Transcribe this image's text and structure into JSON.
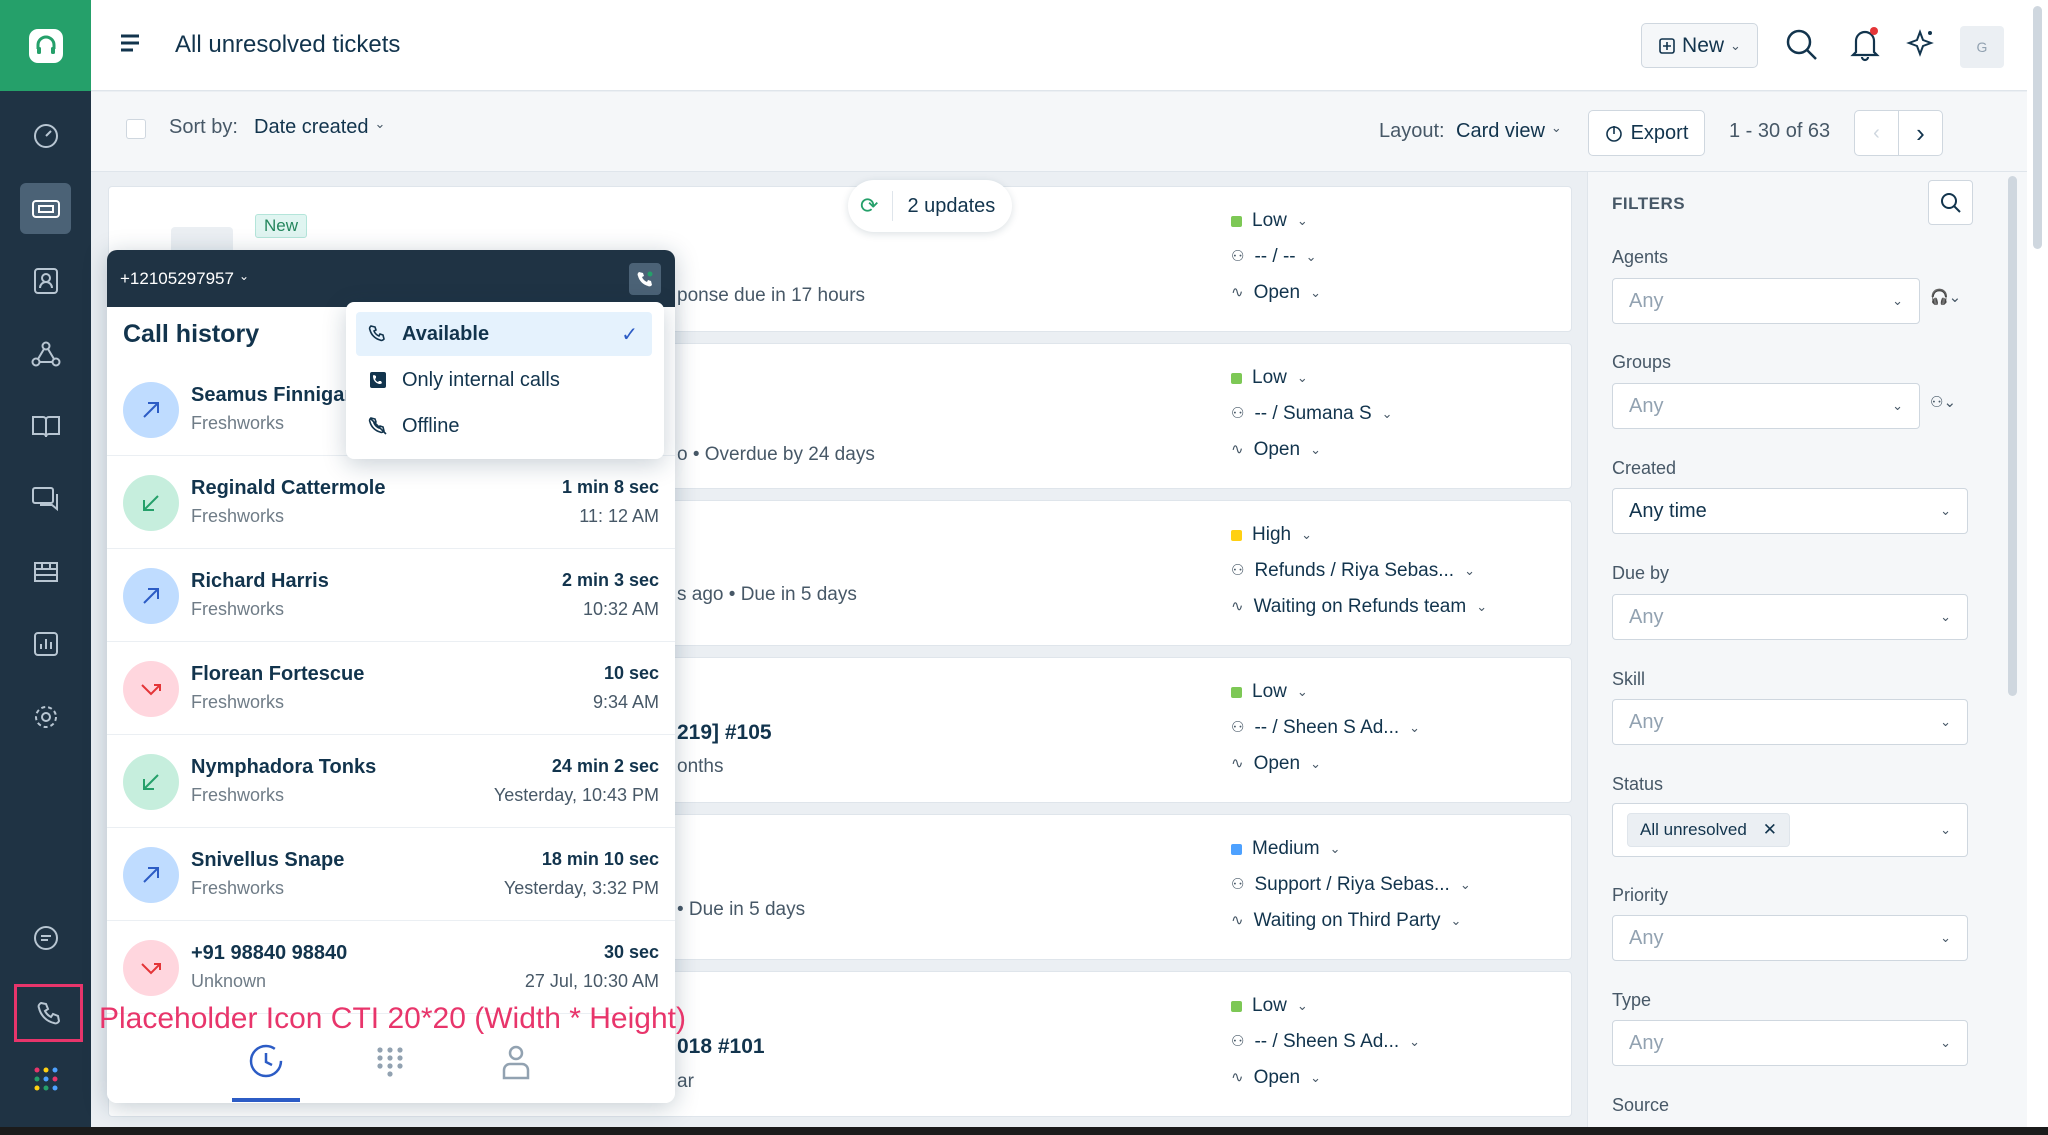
{
  "header": {
    "title": "All unresolved tickets",
    "new_label": "New",
    "avatar_initial": "G"
  },
  "toolbar": {
    "sort_label": "Sort by:",
    "sort_value": "Date created",
    "layout_label": "Layout:",
    "layout_value": "Card view",
    "export_label": "Export",
    "pagination": "1 - 30 of 63"
  },
  "updates_pill": "2 updates",
  "tickets": [
    {
      "badge": "New",
      "snippet": "ponse due in 17 hours",
      "priority": "Low",
      "priority_color": "#7dc855",
      "assignee": "-- / --",
      "status": "Open"
    },
    {
      "snippet": "o • Overdue by 24 days",
      "priority": "Low",
      "priority_color": "#7dc855",
      "assignee": "-- / Sumana S",
      "status": "Open"
    },
    {
      "snippet": "s ago • Due in 5 days",
      "priority": "High",
      "priority_color": "#ffd012",
      "assignee": "Refunds / Riya Sebas...",
      "status": "Waiting on Refunds team"
    },
    {
      "title_snippet": "219] #105",
      "snippet": "onths",
      "priority": "Low",
      "priority_color": "#7dc855",
      "assignee": "-- / Sheen S Ad...",
      "status": "Open"
    },
    {
      "snippet": "• Due in 5 days",
      "priority": "Medium",
      "priority_color": "#4da1ff",
      "assignee": "Support / Riya Sebas...",
      "status": "Waiting on Third Party"
    },
    {
      "title_snippet": "018 #101",
      "snippet": "ar",
      "priority": "Low",
      "priority_color": "#7dc855",
      "assignee": "-- / Sheen S Ad...",
      "status": "Open"
    }
  ],
  "filters": {
    "title": "FILTERS",
    "agents": {
      "label": "Agents",
      "value": "Any"
    },
    "groups": {
      "label": "Groups",
      "value": "Any"
    },
    "created": {
      "label": "Created",
      "value": "Any time"
    },
    "due_by": {
      "label": "Due by",
      "value": "Any"
    },
    "skill": {
      "label": "Skill",
      "value": "Any"
    },
    "status": {
      "label": "Status",
      "value": "All unresolved"
    },
    "priority": {
      "label": "Priority",
      "value": "Any"
    },
    "type": {
      "label": "Type",
      "value": "Any"
    },
    "source": {
      "label": "Source"
    }
  },
  "cti": {
    "phone_number": "+12105297957",
    "title": "Call history",
    "status_options": [
      "Available",
      "Only internal calls",
      "Offline"
    ],
    "calls": [
      {
        "name": "Seamus Finnigan",
        "org": "Freshworks",
        "duration": "",
        "time": "",
        "kind": "outgoing"
      },
      {
        "name": "Reginald Cattermole",
        "org": "Freshworks",
        "duration": "1 min  8 sec",
        "time": "11: 12 AM",
        "kind": "incoming"
      },
      {
        "name": "Richard Harris",
        "org": "Freshworks",
        "duration": "2 min 3 sec",
        "time": "10:32 AM",
        "kind": "outgoing"
      },
      {
        "name": "Florean Fortescue",
        "org": "Freshworks",
        "duration": "10 sec",
        "time": "9:34 AM",
        "kind": "missed"
      },
      {
        "name": "Nymphadora Tonks",
        "org": "Freshworks",
        "duration": "24 min 2 sec",
        "time": "Yesterday, 10:43 PM",
        "kind": "incoming"
      },
      {
        "name": "Snivellus Snape",
        "org": "Freshworks",
        "duration": "18 min 10 sec",
        "time": "Yesterday, 3:32 PM",
        "kind": "outgoing"
      },
      {
        "name": "+91 98840 98840",
        "org": "Unknown",
        "duration": "30 sec",
        "time": "27 Jul, 10:30 AM",
        "kind": "missed"
      }
    ]
  },
  "annotation": "Placeholder Icon CTI 20*20 (Width * Height)",
  "colors": {
    "brand": "#25a06a",
    "sidebar": "#1f3344",
    "annotation": "#e8356b",
    "outgoing": "#bfdcff",
    "incoming": "#c6eedd",
    "missed": "#ffd6de"
  }
}
